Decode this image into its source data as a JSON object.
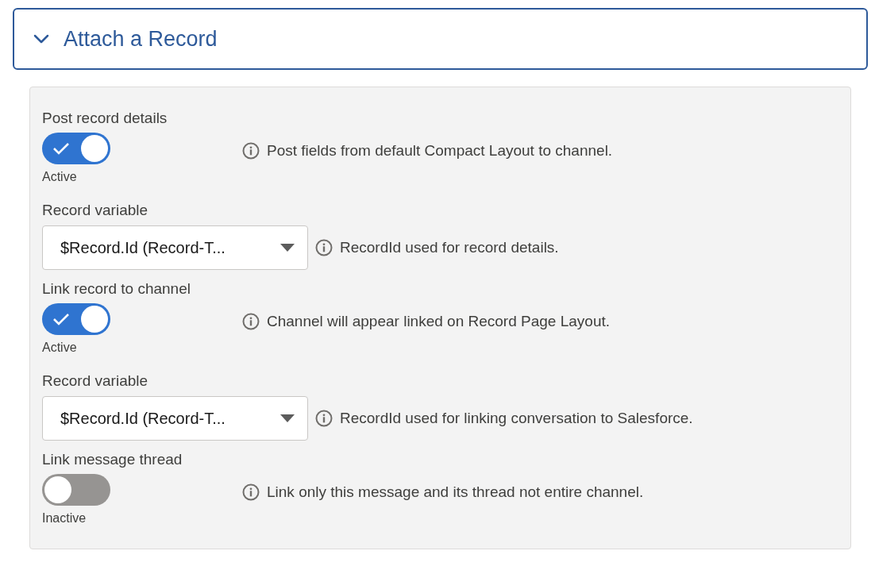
{
  "section": {
    "title": "Attach a Record",
    "expanded": true
  },
  "items": [
    {
      "kind": "toggle",
      "label": "Post record details",
      "on": true,
      "status": "Active",
      "help": "Post fields from default Compact Layout to channel."
    },
    {
      "kind": "select",
      "label": "Record variable",
      "value": "$Record.Id (Record-T...",
      "help": "RecordId used for record details."
    },
    {
      "kind": "toggle",
      "label": "Link record to channel",
      "on": true,
      "status": "Active",
      "help": "Channel will appear linked on Record Page Layout."
    },
    {
      "kind": "select",
      "label": "Record variable",
      "value": "$Record.Id (Record-T...",
      "help": "RecordId used for linking conversation to Salesforce."
    },
    {
      "kind": "toggle",
      "label": "Link message thread",
      "on": false,
      "status": "Inactive",
      "help": "Link only this message and its thread not entire channel."
    }
  ]
}
